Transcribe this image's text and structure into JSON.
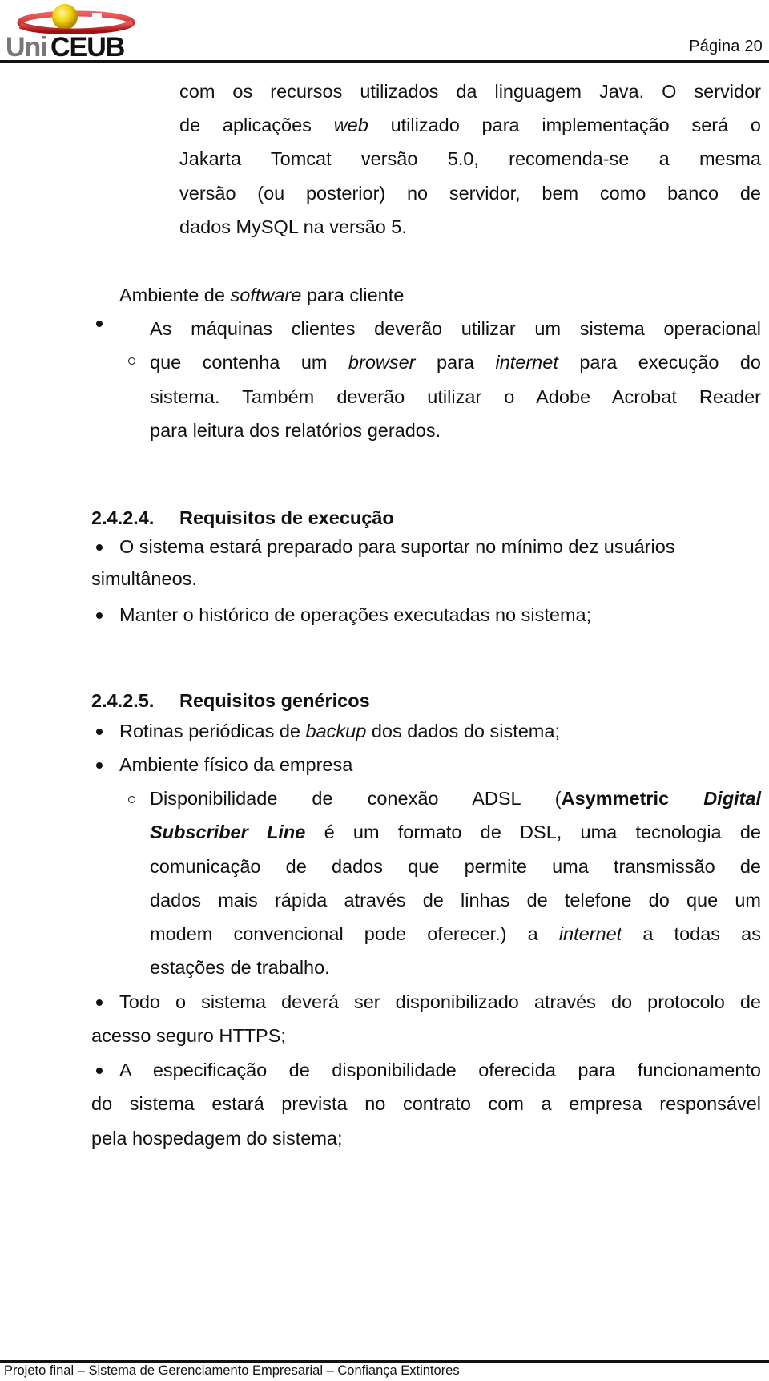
{
  "header": {
    "logo_text": "UniCEUB",
    "page_number": "Página  20"
  },
  "intro": {
    "lines": [
      "com os recursos utilizados da linguagem Java. O servidor",
      [
        "de aplicações ",
        "web",
        " utilizado para implementação será o"
      ],
      "Jakarta Tomcat versão 5.0, recomenda-se a mesma",
      "versão (ou posterior) no servidor, bem como banco de",
      "dados MySQL na versão 5."
    ]
  },
  "software_cliente": {
    "bullet_pre": "Ambiente de ",
    "bullet_em": "software",
    "bullet_post": " para cliente",
    "sub": {
      "l1": "As máquinas clientes deverão utilizar um sistema operacional",
      "l2_a": "que contenha um ",
      "l2_b": "browser",
      "l2_c": " para ",
      "l2_d": "internet",
      "l2_e": " para execução do",
      "l3": "sistema. Também deverão utilizar o Adobe Acrobat Reader",
      "l4": "para leitura dos relatórios gerados."
    }
  },
  "sec_execucao": {
    "number": "2.4.2.4.",
    "title": "Requisitos de execução",
    "items": [
      {
        "l1": "O sistema estará preparado para suportar no mínimo dez usuários",
        "l2": "simultâneos."
      },
      {
        "l1": "Manter o histórico de operações executadas no sistema;"
      }
    ]
  },
  "sec_genericos": {
    "number": "2.4.2.5.",
    "title": "Requisitos genéricos",
    "backup_pre": "Rotinas periódicas de ",
    "backup_em": "backup",
    "backup_post": " dos dados do sistema;",
    "ambiente": "Ambiente físico da empresa",
    "adsl": {
      "l1_a": "Disponibilidade de conexão ADSL (",
      "l1_b": "Asymmetric",
      "l1_c": "Digital",
      "l2_a": "Subscriber Line",
      "l2_b": " é um formato de DSL, uma tecnologia de",
      "l3": "comunicação de dados que permite uma transmissão de",
      "l4": "dados mais rápida através de linhas de telefone do que um",
      "l5_a": "modem convencional pode oferecer.) a ",
      "l5_b": "internet",
      "l5_c": " a todas as",
      "l6": "estações de trabalho."
    },
    "https": {
      "l1": "Todo o sistema deverá ser disponibilizado através do protocolo de",
      "l2": "acesso seguro HTTPS;"
    },
    "disp": {
      "l1": "A especificação de disponibilidade oferecida para funcionamento",
      "l2": "do sistema estará prevista no contrato com a empresa responsável",
      "l3": "pela hospedagem do sistema;"
    }
  },
  "footer": {
    "text": "Projeto final – Sistema de Gerenciamento Empresarial – Confiança Extintores"
  }
}
